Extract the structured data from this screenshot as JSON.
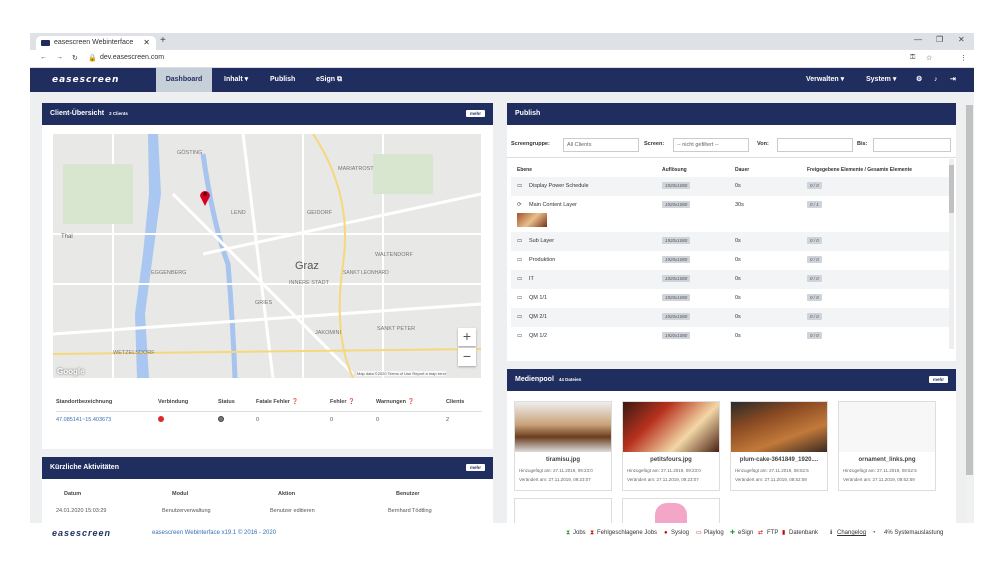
{
  "browser": {
    "tab_title": "easescreen Webinterface",
    "url": "dev.easescreen.com"
  },
  "nav": {
    "logo": "easescreen",
    "dashboard": "Dashboard",
    "inhalt": "Inhalt ▾",
    "publish": "Publish",
    "esign": "eSign ⧉",
    "verwalten": "Verwalten ▾",
    "system": "System ▾"
  },
  "client": {
    "title": "Client-Übersicht",
    "count": "2 Clients",
    "mehr": "mehr",
    "map": {
      "labels": [
        "GÖSTING",
        "MARIATROST",
        "LEND",
        "GEIDORF",
        "Thal",
        "WALTENDORF",
        "Graz",
        "EGGENBERG",
        "SANKT LEONHARD",
        "INNERE STADT",
        "GRIES",
        "JAKOMINI",
        "SANKT PETER",
        "WETZELSDORF"
      ],
      "attribution": "Map data ©2020   Terms of Use   Report a map error",
      "google": "Google"
    },
    "headers": [
      "Standortbezeichnung",
      "Verbindung",
      "Status",
      "Fatale Fehler ❓",
      "Fehler ❓",
      "Warnungen ❓",
      "Clients"
    ],
    "row": {
      "loc": "47.085141~15.403673",
      "fatal": "0",
      "fehler": "0",
      "warn": "0",
      "clients": "2"
    },
    "colors": {
      "red": "#e3262b",
      "gray": "#777777"
    }
  },
  "activity": {
    "title": "Kürzliche Aktivitäten",
    "mehr": "mehr",
    "headers": [
      "Datum",
      "Modul",
      "Aktion",
      "Benutzer"
    ],
    "row": [
      "24.01.2020 15:03:29",
      "Benutzerverwaltung",
      "Benutzer editieren",
      "Bernhard Tödtling"
    ]
  },
  "publish": {
    "title": "Publish",
    "screengruppe": "Screengruppe:",
    "all_clients": "All Clients",
    "screen": "Screen:",
    "screen_val": "-- nicht gefiltert --",
    "von": "Von:",
    "bis": "Bis:",
    "headers": [
      "Ebene",
      "Auflösung",
      "Dauer",
      "Freigegebene Elemente / Gesamte Elemente"
    ],
    "rows": [
      {
        "name": "Display Power Schedule",
        "res": "1920x1080",
        "dur": "0s",
        "ratio": "0 / 0"
      },
      {
        "name": "Main Content Layer",
        "res": "1920x1080",
        "dur": "30s",
        "ratio": "0 / 1"
      },
      {
        "name": "Sub Layer",
        "res": "1920x1080",
        "dur": "0s",
        "ratio": "0 / 0"
      },
      {
        "name": "Produktion",
        "res": "1920x1080",
        "dur": "0s",
        "ratio": "0 / 0"
      },
      {
        "name": "IT",
        "res": "1920x1080",
        "dur": "0s",
        "ratio": "0 / 0"
      },
      {
        "name": "QM 1/1",
        "res": "1920x1080",
        "dur": "0s",
        "ratio": "0 / 0"
      },
      {
        "name": "QM 2/1",
        "res": "1920x1080",
        "dur": "0s",
        "ratio": "0 / 0"
      },
      {
        "name": "QM 1/2",
        "res": "1920x1080",
        "dur": "0s",
        "ratio": "0 / 0"
      }
    ]
  },
  "media": {
    "title": "Medienpool",
    "count": "44 Dateien",
    "mehr": "mehr",
    "items": [
      {
        "name": "tiramisu.jpg",
        "added": "Hinzugefügt am: 27.11.2019, 09:23:0",
        "changed": "Verändert am: 27.11.2019, 09:23:07"
      },
      {
        "name": "petitsfours.jpg",
        "added": "Hinzugefügt am: 27.11.2019, 09:23:0",
        "changed": "Verändert am: 27.11.2019, 09:23:07"
      },
      {
        "name": "plum-cake-3641849_1920....",
        "added": "Hinzugefügt am: 27.11.2019, 08:52:5",
        "changed": "Verändert am: 27.11.2019, 08:52:59"
      },
      {
        "name": "ornament_links.png",
        "added": "Hinzugefügt am: 27.11.2019, 08:52:5",
        "changed": "Verändert am: 27.11.2019, 08:52:59"
      }
    ]
  },
  "footer": {
    "logo": "easescreen",
    "version": "easescreen Webinterface x19.1 © 2016 - 2020",
    "jobs": "Jobs",
    "failed": "Fehlgeschlagene Jobs",
    "syslog": "Syslog",
    "playlog": "Playlog",
    "esign": "eSign",
    "ftp": "FTP",
    "db": "Datenbank",
    "changelog": "Changelog",
    "load": "4% Systemauslastung"
  }
}
